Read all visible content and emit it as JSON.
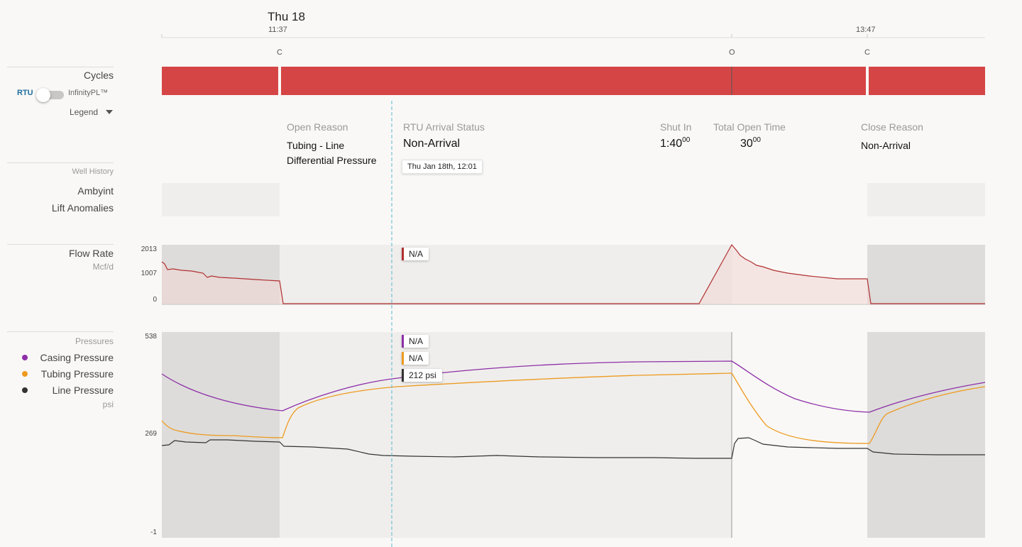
{
  "header": {
    "date_label": "Thu 18",
    "time_ticks": [
      "11:37",
      "13:47"
    ],
    "cycle_markers": [
      "C",
      "O",
      "C"
    ]
  },
  "sidebar": {
    "cycles_label": "Cycles",
    "toggle_left": "RTU",
    "toggle_right": "InfinityPL™",
    "legend_label": "Legend",
    "well_history_label": "Well History",
    "history_items": [
      "Ambyint",
      "Lift Anomalies"
    ],
    "flow_rate_label": "Flow Rate",
    "flow_rate_unit": "Mcf/d",
    "pressures_label": "Pressures",
    "pressure_series": [
      "Casing Pressure",
      "Tubing Pressure",
      "Line Pressure"
    ],
    "pressure_unit": "psi"
  },
  "details": {
    "open_reason_label": "Open Reason",
    "open_reason_value_line1": "Tubing - Line",
    "open_reason_value_line2": "Differential Pressure",
    "arrival_label": "RTU Arrival Status",
    "arrival_value": "Non-Arrival",
    "arrival_tooltip": "Thu Jan 18th, 12:01",
    "shut_in_label": "Shut In",
    "shut_in_main": "1:40",
    "shut_in_sup": "00",
    "total_open_label": "Total Open Time",
    "total_open_main": "30",
    "total_open_sup": "00",
    "close_reason_label": "Close Reason",
    "close_reason_value": "Non-Arrival"
  },
  "flow_chart": {
    "yticks": [
      "2013",
      "1007",
      "0"
    ],
    "flag": "N/A"
  },
  "pressure_chart": {
    "yticks": [
      "538",
      "269",
      "-1"
    ],
    "flags": [
      "N/A",
      "N/A",
      "212 psi"
    ]
  },
  "colors": {
    "cycle_red": "#d64545",
    "flow_line": "#b03030",
    "casing": "#8e2fa8",
    "tubing": "#ee9a1f",
    "line": "#333333",
    "rtu_blue": "#1f6e9e",
    "cursor": "#5bb8cf"
  }
}
